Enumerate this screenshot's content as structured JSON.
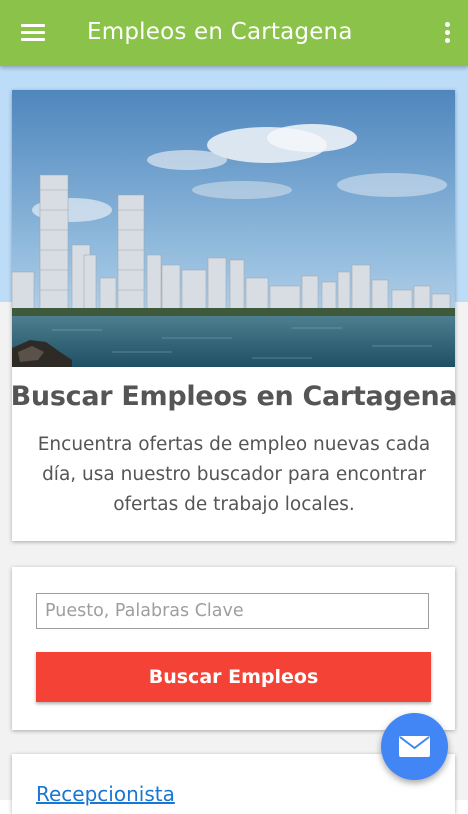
{
  "appbar": {
    "title": "Empleos en Cartagena",
    "menu_icon": "hamburger-menu-icon",
    "overflow_icon": "more-vert-icon",
    "color": "#8bc34a"
  },
  "hero": {
    "image_subject": "Cartagena skyline over the sea",
    "heading": "Buscar Empleos en Cartagena",
    "description": "Encuentra ofertas de empleo nuevas cada día, usa nuestro buscador para encontrar ofertas de trabajo locales."
  },
  "search": {
    "placeholder": "Puesto, Palabras Clave",
    "value": "",
    "button_label": "Buscar Empleos",
    "button_color": "#f44336"
  },
  "jobs": {
    "items": [
      {
        "title": "Recepcionista"
      }
    ]
  },
  "fab": {
    "icon": "mail-icon",
    "color": "#4285f4"
  }
}
